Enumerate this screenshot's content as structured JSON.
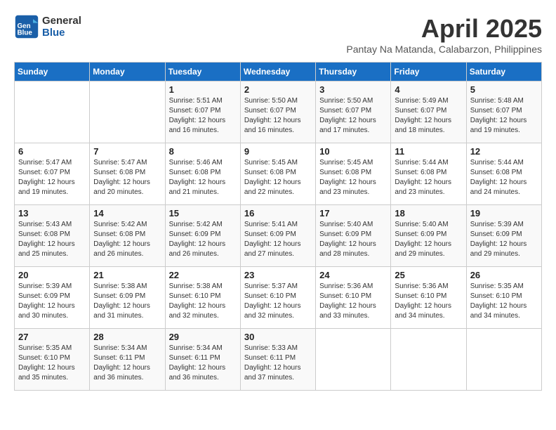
{
  "header": {
    "logo_line1": "General",
    "logo_line2": "Blue",
    "month": "April 2025",
    "location": "Pantay Na Matanda, Calabarzon, Philippines"
  },
  "days_of_week": [
    "Sunday",
    "Monday",
    "Tuesday",
    "Wednesday",
    "Thursday",
    "Friday",
    "Saturday"
  ],
  "weeks": [
    [
      {
        "day": "",
        "info": ""
      },
      {
        "day": "",
        "info": ""
      },
      {
        "day": "1",
        "info": "Sunrise: 5:51 AM\nSunset: 6:07 PM\nDaylight: 12 hours and 16 minutes."
      },
      {
        "day": "2",
        "info": "Sunrise: 5:50 AM\nSunset: 6:07 PM\nDaylight: 12 hours and 16 minutes."
      },
      {
        "day": "3",
        "info": "Sunrise: 5:50 AM\nSunset: 6:07 PM\nDaylight: 12 hours and 17 minutes."
      },
      {
        "day": "4",
        "info": "Sunrise: 5:49 AM\nSunset: 6:07 PM\nDaylight: 12 hours and 18 minutes."
      },
      {
        "day": "5",
        "info": "Sunrise: 5:48 AM\nSunset: 6:07 PM\nDaylight: 12 hours and 19 minutes."
      }
    ],
    [
      {
        "day": "6",
        "info": "Sunrise: 5:47 AM\nSunset: 6:07 PM\nDaylight: 12 hours and 19 minutes."
      },
      {
        "day": "7",
        "info": "Sunrise: 5:47 AM\nSunset: 6:08 PM\nDaylight: 12 hours and 20 minutes."
      },
      {
        "day": "8",
        "info": "Sunrise: 5:46 AM\nSunset: 6:08 PM\nDaylight: 12 hours and 21 minutes."
      },
      {
        "day": "9",
        "info": "Sunrise: 5:45 AM\nSunset: 6:08 PM\nDaylight: 12 hours and 22 minutes."
      },
      {
        "day": "10",
        "info": "Sunrise: 5:45 AM\nSunset: 6:08 PM\nDaylight: 12 hours and 23 minutes."
      },
      {
        "day": "11",
        "info": "Sunrise: 5:44 AM\nSunset: 6:08 PM\nDaylight: 12 hours and 23 minutes."
      },
      {
        "day": "12",
        "info": "Sunrise: 5:44 AM\nSunset: 6:08 PM\nDaylight: 12 hours and 24 minutes."
      }
    ],
    [
      {
        "day": "13",
        "info": "Sunrise: 5:43 AM\nSunset: 6:08 PM\nDaylight: 12 hours and 25 minutes."
      },
      {
        "day": "14",
        "info": "Sunrise: 5:42 AM\nSunset: 6:08 PM\nDaylight: 12 hours and 26 minutes."
      },
      {
        "day": "15",
        "info": "Sunrise: 5:42 AM\nSunset: 6:09 PM\nDaylight: 12 hours and 26 minutes."
      },
      {
        "day": "16",
        "info": "Sunrise: 5:41 AM\nSunset: 6:09 PM\nDaylight: 12 hours and 27 minutes."
      },
      {
        "day": "17",
        "info": "Sunrise: 5:40 AM\nSunset: 6:09 PM\nDaylight: 12 hours and 28 minutes."
      },
      {
        "day": "18",
        "info": "Sunrise: 5:40 AM\nSunset: 6:09 PM\nDaylight: 12 hours and 29 minutes."
      },
      {
        "day": "19",
        "info": "Sunrise: 5:39 AM\nSunset: 6:09 PM\nDaylight: 12 hours and 29 minutes."
      }
    ],
    [
      {
        "day": "20",
        "info": "Sunrise: 5:39 AM\nSunset: 6:09 PM\nDaylight: 12 hours and 30 minutes."
      },
      {
        "day": "21",
        "info": "Sunrise: 5:38 AM\nSunset: 6:09 PM\nDaylight: 12 hours and 31 minutes."
      },
      {
        "day": "22",
        "info": "Sunrise: 5:38 AM\nSunset: 6:10 PM\nDaylight: 12 hours and 32 minutes."
      },
      {
        "day": "23",
        "info": "Sunrise: 5:37 AM\nSunset: 6:10 PM\nDaylight: 12 hours and 32 minutes."
      },
      {
        "day": "24",
        "info": "Sunrise: 5:36 AM\nSunset: 6:10 PM\nDaylight: 12 hours and 33 minutes."
      },
      {
        "day": "25",
        "info": "Sunrise: 5:36 AM\nSunset: 6:10 PM\nDaylight: 12 hours and 34 minutes."
      },
      {
        "day": "26",
        "info": "Sunrise: 5:35 AM\nSunset: 6:10 PM\nDaylight: 12 hours and 34 minutes."
      }
    ],
    [
      {
        "day": "27",
        "info": "Sunrise: 5:35 AM\nSunset: 6:10 PM\nDaylight: 12 hours and 35 minutes."
      },
      {
        "day": "28",
        "info": "Sunrise: 5:34 AM\nSunset: 6:11 PM\nDaylight: 12 hours and 36 minutes."
      },
      {
        "day": "29",
        "info": "Sunrise: 5:34 AM\nSunset: 6:11 PM\nDaylight: 12 hours and 36 minutes."
      },
      {
        "day": "30",
        "info": "Sunrise: 5:33 AM\nSunset: 6:11 PM\nDaylight: 12 hours and 37 minutes."
      },
      {
        "day": "",
        "info": ""
      },
      {
        "day": "",
        "info": ""
      },
      {
        "day": "",
        "info": ""
      }
    ]
  ]
}
